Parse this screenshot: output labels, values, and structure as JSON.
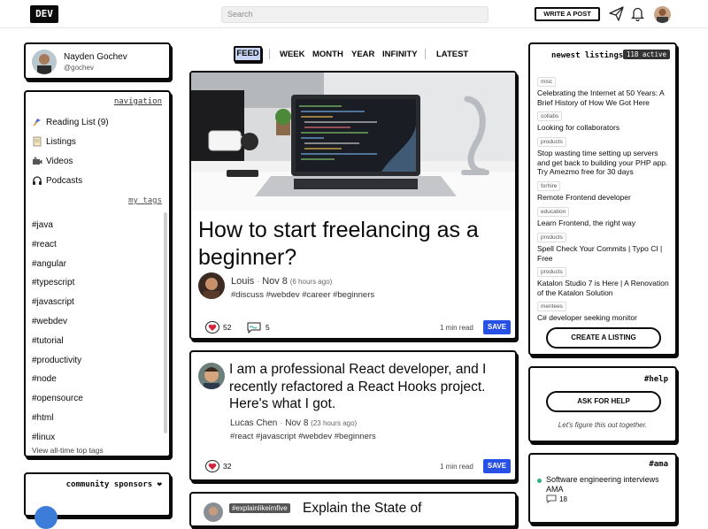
{
  "brand": {
    "logo": "DEV"
  },
  "header": {
    "search_placeholder": "Search",
    "write_post": "WRITE A POST"
  },
  "profile": {
    "name": "Nayden Gochev",
    "username": "@gochev"
  },
  "sidebar": {
    "nav_title": "navigation",
    "items": [
      {
        "label": "Reading List (9)",
        "icon": "bookmark-icon"
      },
      {
        "label": "Listings",
        "icon": "document-icon"
      },
      {
        "label": "Videos",
        "icon": "camera-icon"
      },
      {
        "label": "Podcasts",
        "icon": "headphones-icon"
      }
    ],
    "my_tags_title": "my_tags",
    "tags": [
      "#java",
      "#react",
      "#angular",
      "#typescript",
      "#javascript",
      "#webdev",
      "#tutorial",
      "#productivity",
      "#node",
      "#opensource",
      "#html",
      "#linux"
    ],
    "all_top_tags": "View all-time top tags"
  },
  "sponsors": {
    "title": "community sponsors ❤"
  },
  "feed_tabs": [
    "FEED",
    "WEEK",
    "MONTH",
    "YEAR",
    "INFINITY",
    "LATEST"
  ],
  "articles": [
    {
      "title": "How to start freelancing as a beginner?",
      "author": "Louis",
      "date": "Nov 8",
      "ago": "(6 hours ago)",
      "tags": "#discuss #webdev #career #beginners",
      "reactions": "52",
      "comments": "5",
      "read_time": "1 min read",
      "save": "SAVE"
    },
    {
      "title": "I am a professional React developer, and I recently refactored a React Hooks project. Here's what I got.",
      "author": "Lucas Chen",
      "date": "Nov 8",
      "ago": "(23 hours ago)",
      "tags": "#react #javascript #webdev #beginners",
      "reactions": "32",
      "read_time": "1 min read",
      "save": "SAVE"
    },
    {
      "badge": "#explainlikeimfive",
      "title": "Explain the State of"
    }
  ],
  "listings": {
    "title": "newest listings",
    "badge": "118 active",
    "items": [
      {
        "category": "misc",
        "title": "Celebrating the Internet at 50 Years: A Brief History of How We Got Here"
      },
      {
        "category": "collabs",
        "title": "Looking for collaborators"
      },
      {
        "category": "products",
        "title": "Stop wasting time setting up servers and get back to building your PHP app. Try Amezmo free for 30 days"
      },
      {
        "category": "forhire",
        "title": "Remote Frontend developer"
      },
      {
        "category": "education",
        "title": "Learn Frontend, the right way"
      },
      {
        "category": "products",
        "title": "Spell Check Your Commits | Typo CI | Free"
      },
      {
        "category": "products",
        "title": "Katalon Studio 7 is Here | A Renovation of the Katalon Solution"
      },
      {
        "category": "mentees",
        "title": "C# developer seeking monitor"
      }
    ],
    "create": "CREATE A LISTING"
  },
  "help": {
    "title": "#help",
    "button": "ASK FOR HELP",
    "subtitle": "Let's figure this out together."
  },
  "ama": {
    "title": "#ama",
    "item": "Software engineering interviews AMA",
    "comments": "18"
  }
}
